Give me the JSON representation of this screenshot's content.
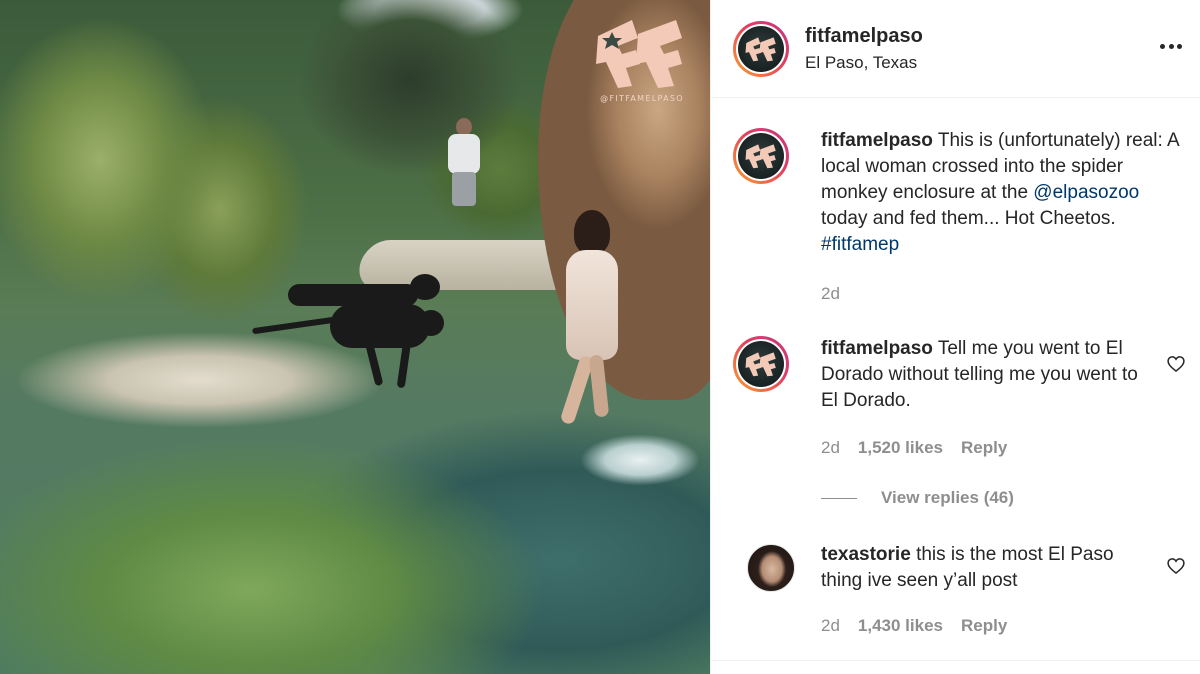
{
  "media": {
    "watermark_text": "@FITFAMELPASO",
    "watermark_logo": "FF"
  },
  "header": {
    "username": "fitfamelpaso",
    "location": "El Paso, Texas",
    "more_icon": "more-horizontal-icon"
  },
  "caption": {
    "username": "fitfamelpaso",
    "text_1": "This is (unfortunately) real: A local woman crossed into the spider monkey enclosure at the ",
    "mention": "@elpasozoo",
    "text_2": " today and fed them... Hot Cheetos. ",
    "hashtag": "#fitfamep",
    "time": "2d"
  },
  "comments": [
    {
      "username": "fitfamelpaso",
      "text": "Tell me you went to El Dorado without telling me you went to El Dorado.",
      "time": "2d",
      "likes": "1,520 likes",
      "reply_label": "Reply",
      "view_replies": "View replies (46)"
    },
    {
      "username": "texastorie",
      "text": "this is the most El Paso thing ive seen y’all post",
      "time": "2d",
      "likes": "1,430 likes",
      "reply_label": "Reply"
    }
  ],
  "colors": {
    "link": "#00376b",
    "muted": "#8e8e8e",
    "text": "#262626"
  }
}
